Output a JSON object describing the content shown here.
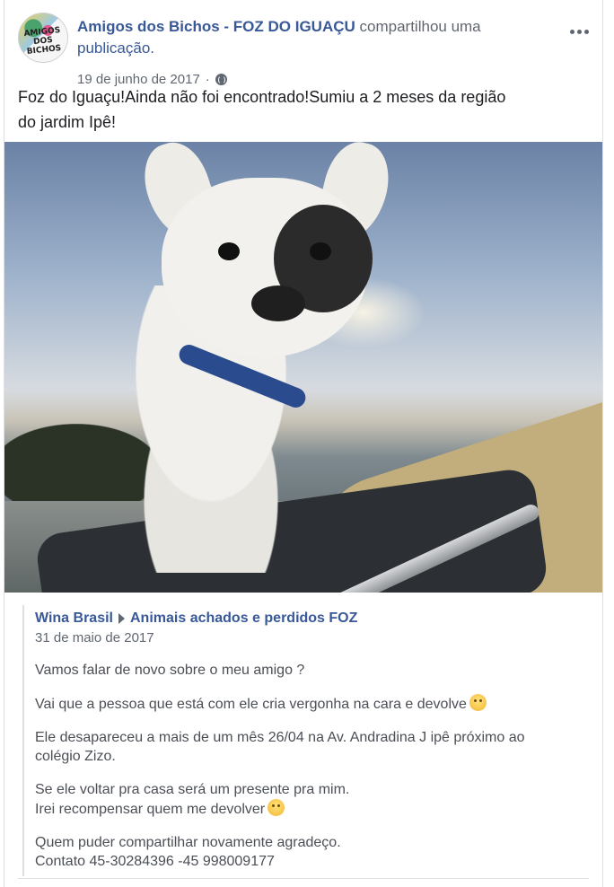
{
  "post": {
    "author": "Amigos dos Bichos - FOZ DO IGUAÇU",
    "action_text": " compartilhou uma ",
    "action_link": "publicação.",
    "date": "19 de junho de 2017",
    "separator": "·",
    "privacy_icon": "globe-icon",
    "more_icon": "more-options-icon",
    "text_line1": "Foz do Iguaçu!Ainda não foi encontrado!Sumiu a 2 meses da região",
    "text_line2": "do jardim Ipê!",
    "avatar_text": "AMIGOS DOS BICHOS"
  },
  "shared_post": {
    "author": "Wina Brasil",
    "group": "Animais achados e perdidos FOZ",
    "date": "31 de maio de 2017",
    "paragraphs": {
      "p1": "Vamos falar de novo sobre o meu amigo ?",
      "p2": "Vai que a pessoa que está com ele cria vergonha na cara e devolve",
      "p3_line1": "Ele desapareceu a mais de um mês 26/04 na Av. Andradina J ipê próximo ao",
      "p3_line2": "colégio Zizo.",
      "p4_line1": "Se ele voltar pra casa será um presente pra mim.",
      "p4_line2": "Irei recompensar quem me devolver",
      "p5_line1": "Quem puder compartilhar novamente agradeço.",
      "p5_line2": "Contato 45-30284396 -45 998009177"
    },
    "emoji_1": "face-with-rolling-eyes-emoji",
    "emoji_2": "confused-face-emoji"
  },
  "colors": {
    "link": "#385898",
    "secondary_text": "#606770",
    "body_text": "#1c1e21",
    "border": "#dddfe2"
  }
}
